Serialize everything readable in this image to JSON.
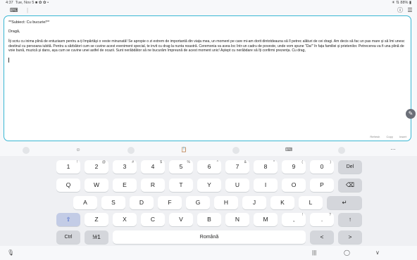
{
  "status": {
    "time": "4:37",
    "date": "Tue, Nov 5",
    "left_icons": "■ ✿ ✿ •",
    "right": "☀ ⇅ 88% ▮"
  },
  "toolbar": {
    "left_icon": "keyboard-icon",
    "right_icons": [
      "info-icon",
      "sort-icon"
    ]
  },
  "editor": {
    "subject": "**Subiect: Cu bucurie!**",
    "greeting": "Dragă,",
    "body": "Îți scriu cu inima plină de entuziasm pentru a-ți împărtăși o veste minunată! Se apropie o zi extrem de importantă din viața mea, un moment pe care mi-am dorit dintotdeauna să îl petrec alături de cei dragi.  Am decis să fac un pas mare și să îmi unesc destinul cu persoana iubită.  Pentru a sărbători cum se cuvine acest eveniment special, te invit cu drag la nunta noastră.  Ceremonia va avea loc într-un cadru de poveste, unde vom spune \"Da!\" în fața familiei și prietenilor.  Petrecerea va fi una plină de voie bună, muzică și dans, așa cum se cuvine unei astfel de ocazii.  Sunt nerăbdător să ne bucurăm împreună de acest moment unic!  Aștept cu nerăbdare să îți confirmi prezența.  Cu drag,",
    "actions": [
      "Refresh",
      "Copy",
      "Insert"
    ]
  },
  "kb_toolbar": [
    "⌄",
    "☺",
    "▢",
    "📋",
    "▭",
    "⌨",
    "◯",
    "⋯"
  ],
  "keyboard": {
    "row1": [
      {
        "k": "1",
        "s": "!"
      },
      {
        "k": "2",
        "s": "@"
      },
      {
        "k": "3",
        "s": "#"
      },
      {
        "k": "4",
        "s": "$"
      },
      {
        "k": "5",
        "s": "%"
      },
      {
        "k": "6",
        "s": "^"
      },
      {
        "k": "7",
        "s": "&"
      },
      {
        "k": "8",
        "s": "*"
      },
      {
        "k": "9",
        "s": "("
      },
      {
        "k": "0",
        "s": ")"
      }
    ],
    "del": "Del",
    "row2": [
      "Q",
      "W",
      "E",
      "R",
      "T",
      "Y",
      "U",
      "I",
      "O",
      "P"
    ],
    "backspace": "⌫",
    "row3": [
      "A",
      "S",
      "D",
      "F",
      "G",
      "H",
      "J",
      "K",
      "L"
    ],
    "enter": "↵",
    "shift": "⇧",
    "row4": [
      {
        "k": "Z",
        "s": ""
      },
      {
        "k": "X",
        "s": ""
      },
      {
        "k": "C",
        "s": ""
      },
      {
        "k": "V",
        "s": ""
      },
      {
        "k": "B",
        "s": ""
      },
      {
        "k": "N",
        "s": ""
      },
      {
        "k": "M",
        "s": ""
      },
      {
        "k": ",",
        "s": "!"
      },
      {
        "k": ".",
        "s": "?"
      }
    ],
    "ctrl": "Ctrl",
    "sym": "!#1",
    "space": "Română",
    "left": "<",
    "right": ">"
  },
  "navbar": {
    "mic": "🎙",
    "recent": "|||",
    "home": "◯",
    "back": "∨"
  }
}
